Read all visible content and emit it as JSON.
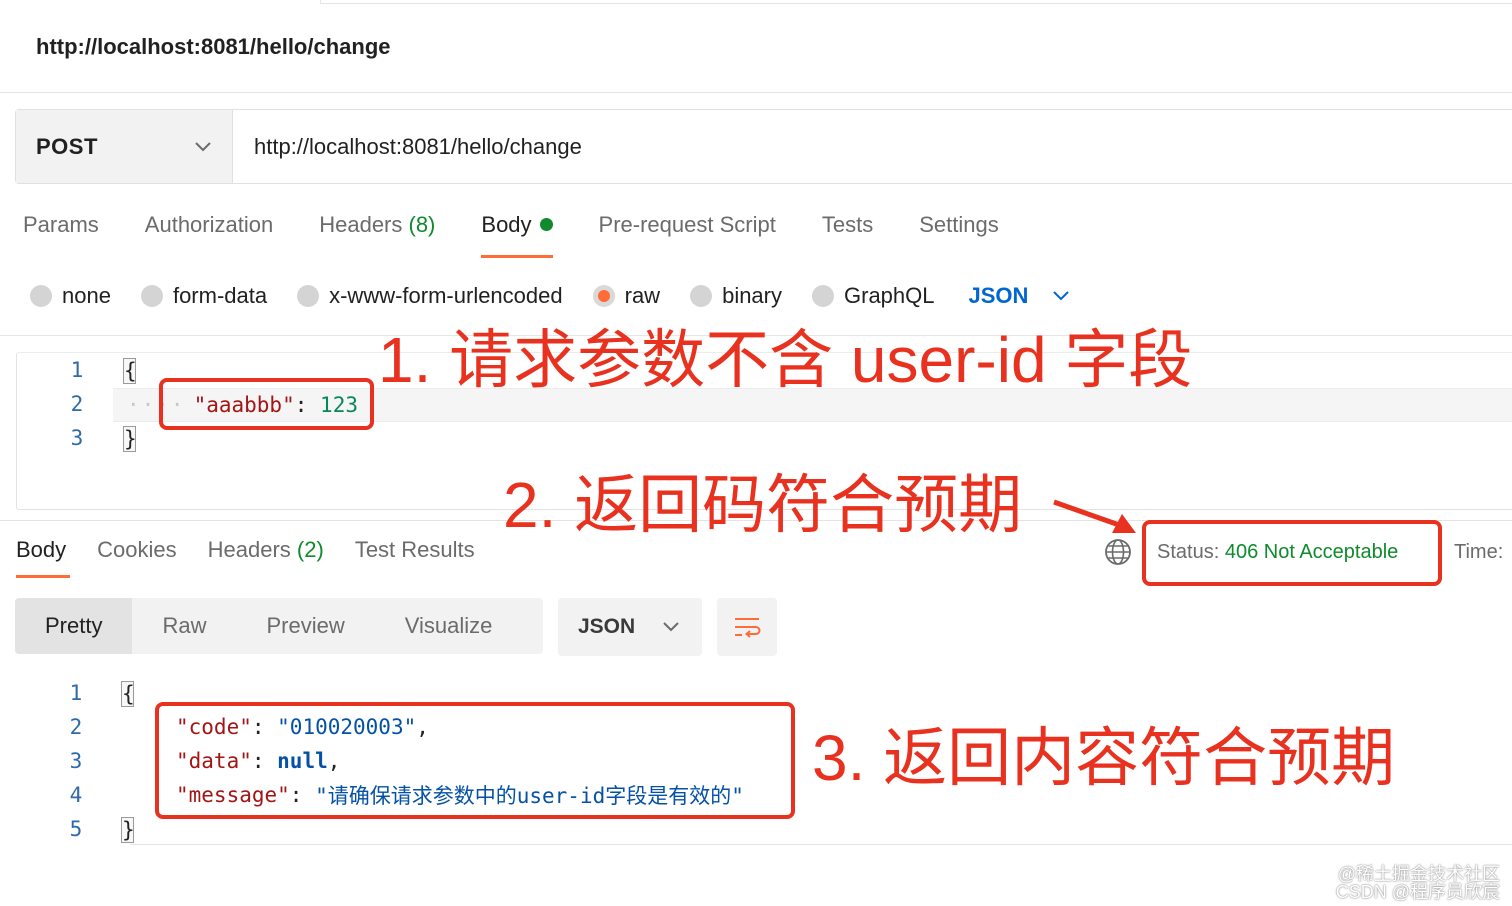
{
  "request": {
    "title": "http://localhost:8081/hello/change",
    "method": "POST",
    "url": "http://localhost:8081/hello/change"
  },
  "request_tabs": {
    "params": "Params",
    "authorization": "Authorization",
    "headers": "Headers",
    "headers_count": "(8)",
    "body": "Body",
    "pre_request": "Pre-request Script",
    "tests": "Tests",
    "settings": "Settings"
  },
  "body_types": {
    "none": "none",
    "form_data": "form-data",
    "urlencoded": "x-www-form-urlencoded",
    "raw": "raw",
    "binary": "binary",
    "graphql": "GraphQL",
    "selected_format": "JSON"
  },
  "request_body": {
    "line_numbers": [
      "1",
      "2",
      "3"
    ],
    "open": "{",
    "key": "\"aaabbb\"",
    "colon": ":",
    "value": "123",
    "close": "}"
  },
  "response_tabs": {
    "body": "Body",
    "cookies": "Cookies",
    "headers": "Headers",
    "headers_count": "(2)",
    "test_results": "Test Results"
  },
  "response_status": {
    "label": "Status:",
    "value": "406 Not Acceptable",
    "time_label": "Time:"
  },
  "response_view": {
    "pretty": "Pretty",
    "raw": "Raw",
    "preview": "Preview",
    "visualize": "Visualize",
    "format": "JSON"
  },
  "response_body": {
    "line_numbers": [
      "1",
      "2",
      "3",
      "4",
      "5"
    ],
    "open": "{",
    "code_key": "\"code\"",
    "code_value": "\"010020003\"",
    "data_key": "\"data\"",
    "data_value": "null",
    "message_key": "\"message\"",
    "message_value": "\"请确保请求参数中的user-id字段是有效的\"",
    "close": "}"
  },
  "annotations": {
    "note1": "1. 请求参数不含 user-id 字段",
    "note2": "2. 返回码符合预期",
    "note3": "3. 返回内容符合预期",
    "color": "#e8311e"
  },
  "watermark": {
    "line1": "@稀土掘金技术社区",
    "line2": "CSDN @程序员欣宸"
  },
  "colors": {
    "accent": "#ff6c37",
    "success": "#0f8a2c",
    "link": "#0265d2"
  }
}
